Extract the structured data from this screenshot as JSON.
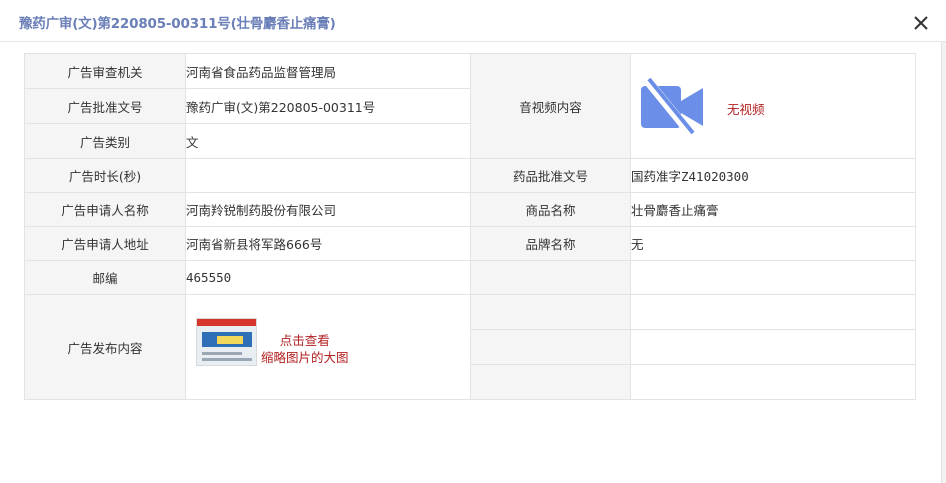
{
  "dialog": {
    "title": "豫药广审(文)第220805-00311号(壮骨麝香止痛膏)"
  },
  "labels": {
    "agency": "广告审查机关",
    "approval_no": "广告批准文号",
    "category": "广告类别",
    "duration": "广告时长(秒)",
    "applicant_name": "广告申请人名称",
    "applicant_address": "广告申请人地址",
    "postcode": "邮编",
    "ad_content": "广告发布内容",
    "av_content": "音视频内容",
    "drug_approval_no": "药品批准文号",
    "product_name": "商品名称",
    "brand_name": "品牌名称"
  },
  "values": {
    "agency": "河南省食品药品监督管理局",
    "approval_no": "豫药广审(文)第220805-00311号",
    "category": "文",
    "duration": "",
    "applicant_name": "河南羚锐制药股份有限公司",
    "applicant_address": "河南省新县将军路666号",
    "postcode": "465550",
    "no_video": "无视频",
    "drug_approval_no": "国药准字Z41020300",
    "product_name": "壮骨麝香止痛膏",
    "brand_name": "无"
  },
  "ad_image": {
    "link_line1": "点击查看",
    "link_line2": "缩略图片的大图"
  },
  "colors": {
    "title": "#6b7fb8",
    "video_icon": "#6b8fe8",
    "link_red": "#b22222",
    "label_bg": "#f5f5f5"
  },
  "icons": {
    "close": "close-icon",
    "video": "video-off-icon"
  }
}
